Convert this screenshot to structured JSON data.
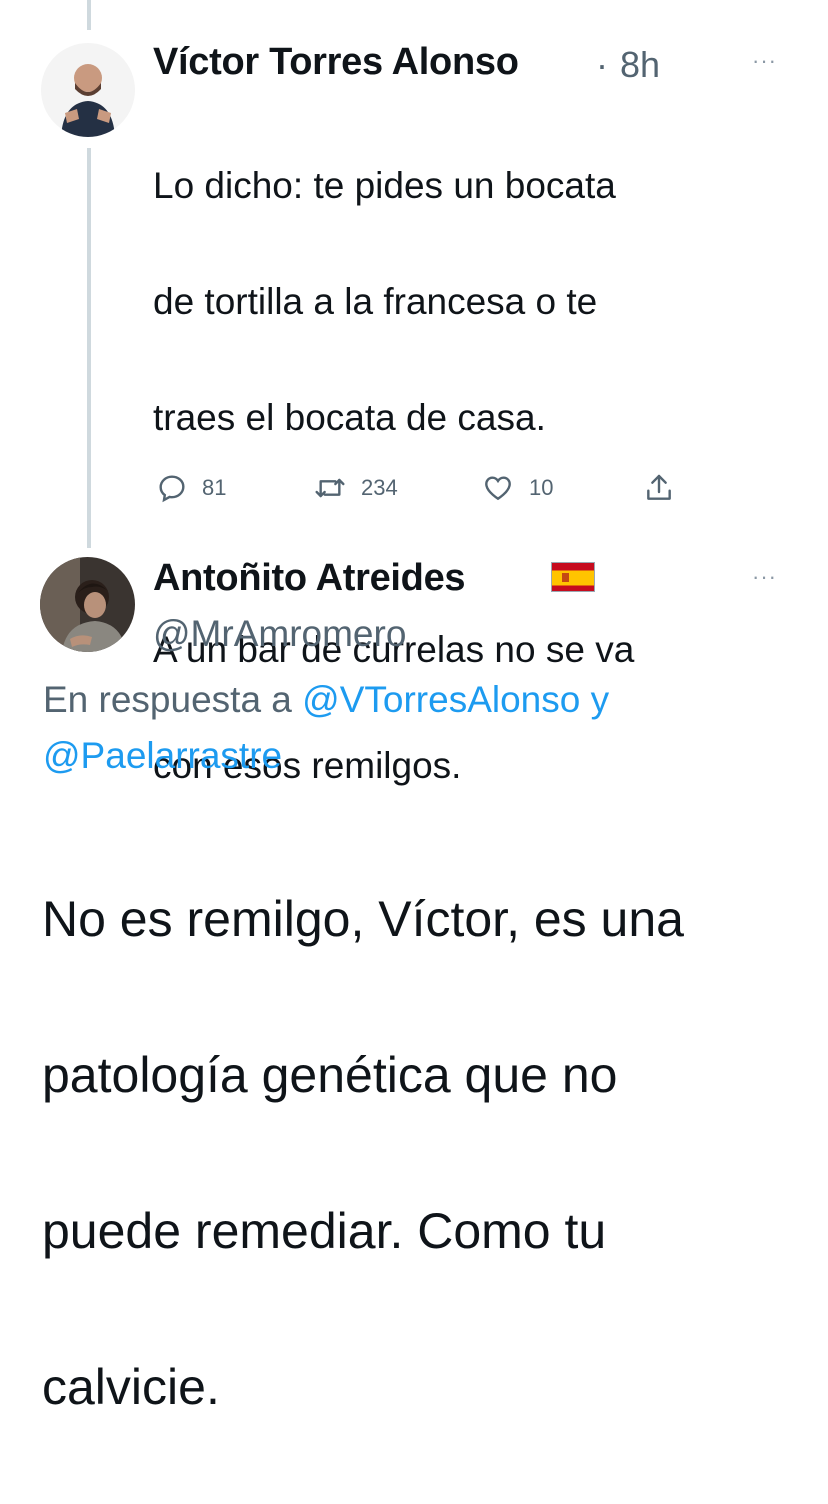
{
  "tweet1": {
    "author_name": "Víctor Torres Alonso",
    "dot": "·",
    "time": "8h",
    "more": "···",
    "text_lines": [
      "Lo dicho: te pides un bocata",
      "de tortilla a la francesa o te",
      "traes el bocata de casa.",
      "",
      "A un bar de currelas no se va",
      "con esos remilgos."
    ],
    "actions": {
      "replies": "81",
      "retweets": "234",
      "likes": "10"
    }
  },
  "tweet2": {
    "author_name": "Antoñito Atreides",
    "flag_icon": "spain-flag-icon",
    "handle": "@MrAmromero",
    "more": "···",
    "reply_prefix": "En respuesta a ",
    "mention1": "@VTorresAlonso",
    "reply_join": " y",
    "mention2": "@Paelarrastre",
    "text_lines": [
      "No es remilgo, Víctor, es una",
      "patología genética que no",
      "puede remediar. Como tu",
      "calvicie."
    ]
  },
  "colors": {
    "text": "#0f1419",
    "secondary": "#536471",
    "link": "#1d9bf0",
    "thread_line": "#cfd9de"
  }
}
